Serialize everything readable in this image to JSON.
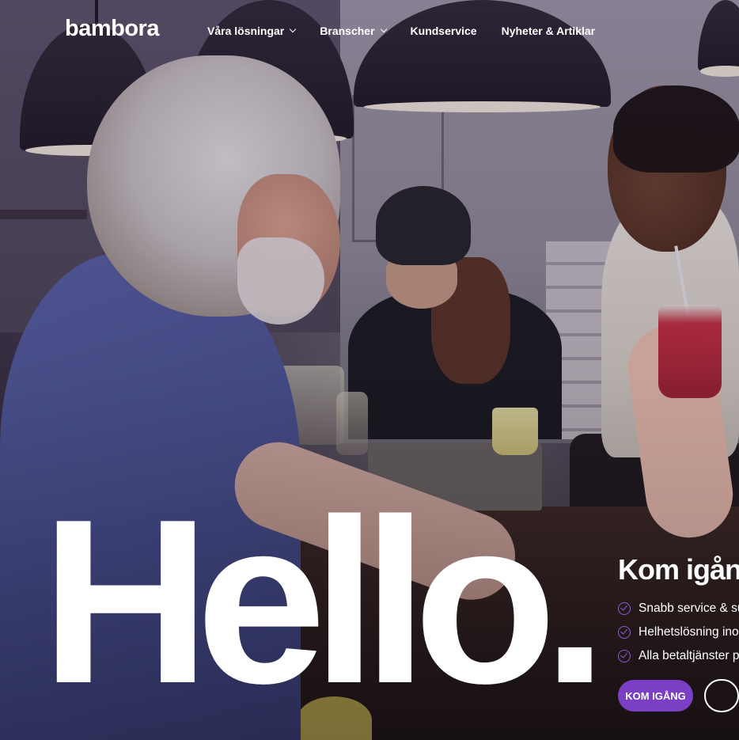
{
  "header": {
    "logo": "bambora",
    "nav": [
      {
        "label": "Våra lösningar",
        "has_dropdown": true
      },
      {
        "label": "Branscher",
        "has_dropdown": true
      },
      {
        "label": "Kundservice",
        "has_dropdown": false
      },
      {
        "label": "Nyheter & Artiklar",
        "has_dropdown": false
      }
    ]
  },
  "hero": {
    "headline": "Hello.",
    "cta": {
      "title": "Kom igång",
      "bullets": [
        "Snabb service & support",
        "Helhetslösning inom betalningar",
        "Alla betaltjänster på ett ställe"
      ],
      "primary_button": "KOM IGÅNG",
      "secondary_button": ""
    }
  },
  "colors": {
    "accent": "#7b3fc6",
    "check": "#8f5bd9",
    "text": "#ffffff"
  }
}
